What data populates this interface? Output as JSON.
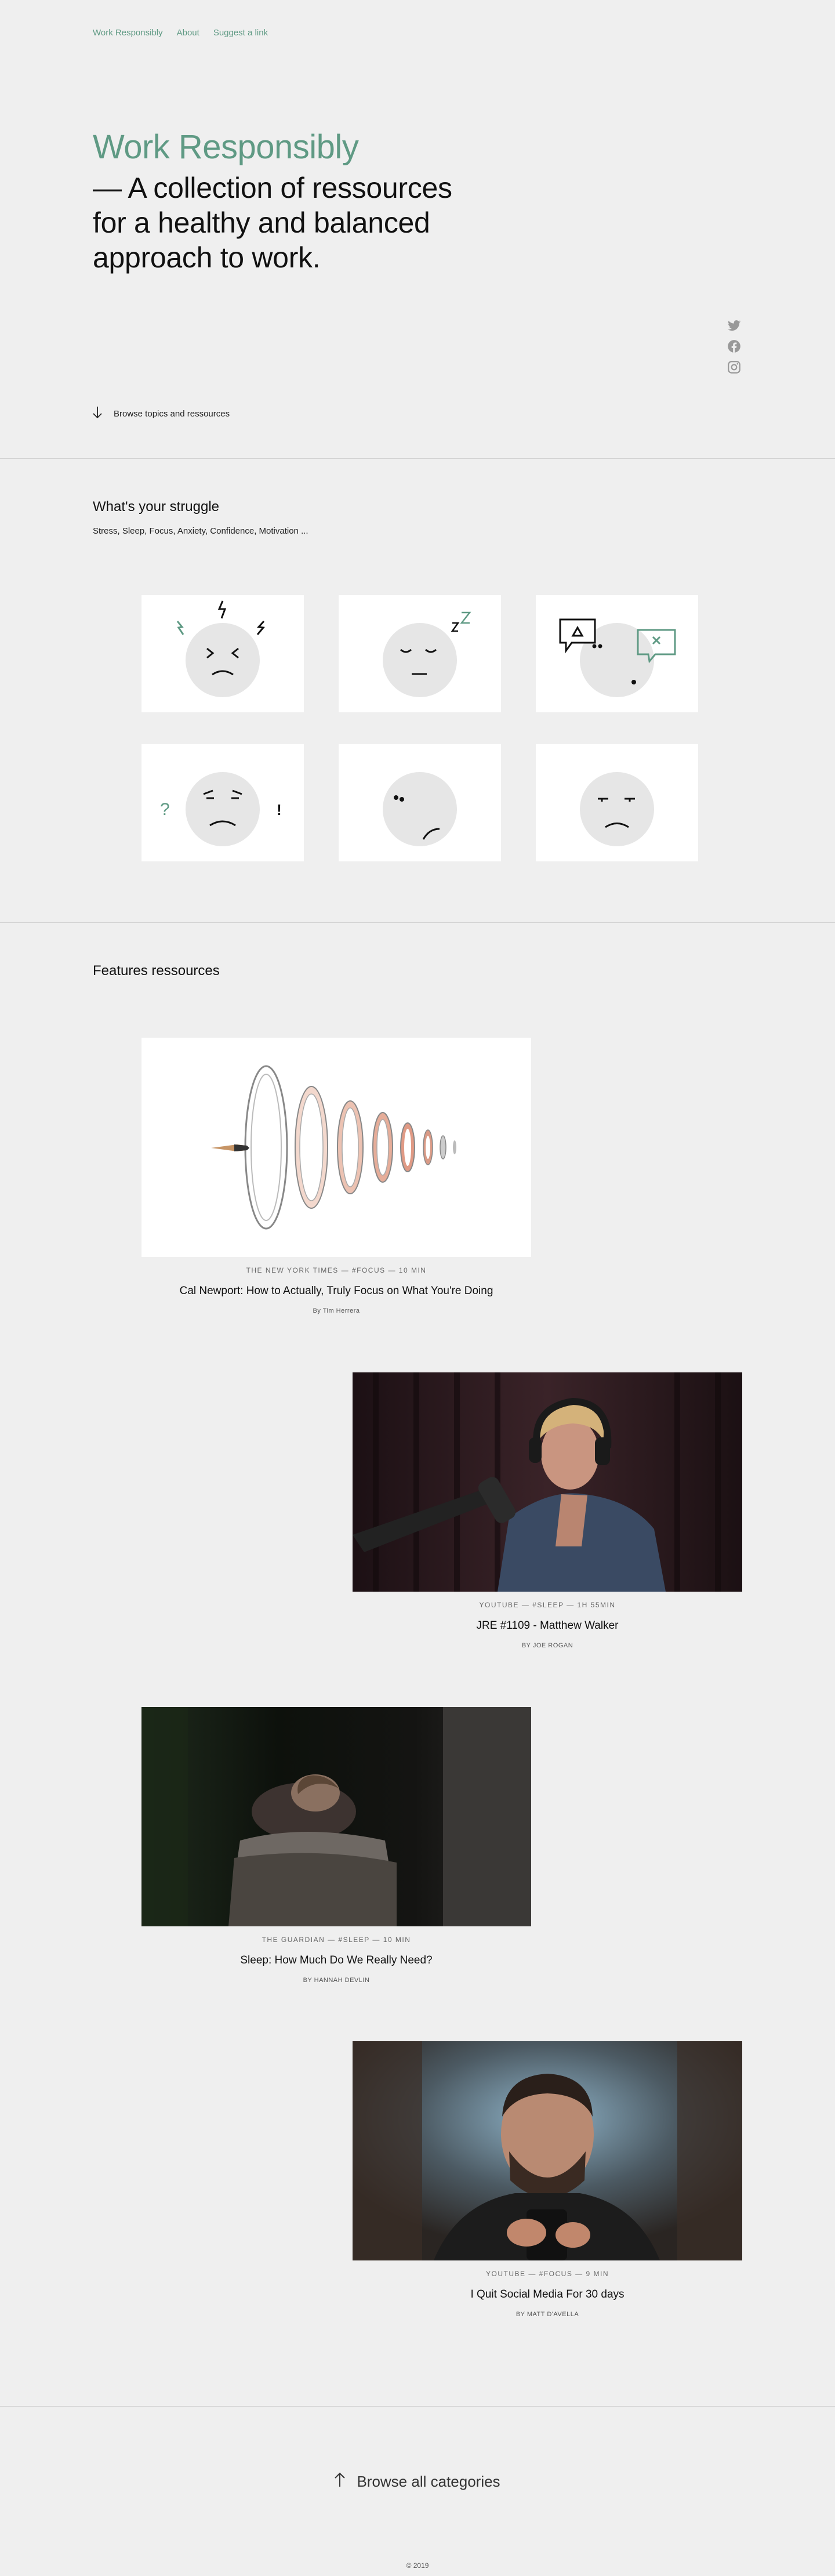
{
  "nav": {
    "links": [
      "Work Responsibly",
      "About",
      "Suggest a link"
    ]
  },
  "hero": {
    "title": "Work Responsibly",
    "subtitle": "— A collection of ressources for a healthy and balanced approach to work."
  },
  "social": {
    "icons": [
      "twitter-icon",
      "facebook-icon",
      "instagram-icon"
    ]
  },
  "browse_topics": {
    "label": "Browse topics and ressources",
    "icon": "arrow-down-icon"
  },
  "struggle": {
    "title": "What's your struggle",
    "description": "Stress, Sleep, Focus, Anxiety, Confidence, Motivation ...",
    "cards": [
      "stress",
      "sleep",
      "focus",
      "anxiety",
      "confidence",
      "motivation"
    ]
  },
  "features": {
    "title": "Features ressources",
    "items": [
      {
        "meta": "THE NEW YORK TIMES — #FOCUS — 10 MIN",
        "title": "Cal Newport: How to Actually, Truly Focus on What You're Doing",
        "author": "By Tim Herrera"
      },
      {
        "meta": "YOUTUBE — #SLEEP — 1H 55MIN",
        "title": "JRE #1109 - Matthew Walker",
        "author": "BY JOE ROGAN"
      },
      {
        "meta": "THE GUARDIAN — #SLEEP — 10 MIN",
        "title": "Sleep: How Much Do We Really Need?",
        "author": "BY HANNAH DEVLIN"
      },
      {
        "meta": "YOUTUBE — #FOCUS — 9 MIN",
        "title": "I Quit Social Media For 30 days",
        "author": "BY MATT D'AVELLA"
      }
    ]
  },
  "browse_all": {
    "label": "Browse all categories",
    "icon": "arrow-up-icon"
  },
  "footer": {
    "copyright": "© 2019"
  },
  "colors": {
    "accent": "#5f9a84",
    "background": "#efefef",
    "text": "#111111"
  }
}
